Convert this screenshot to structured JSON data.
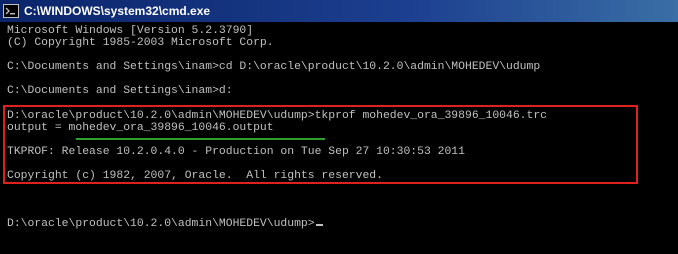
{
  "window": {
    "title": "C:\\WINDOWS\\system32\\cmd.exe"
  },
  "console": {
    "lines": [
      "Microsoft Windows [Version 5.2.3790]",
      "(C) Copyright 1985-2003 Microsoft Corp.",
      "",
      "C:\\Documents and Settings\\inam>cd D:\\oracle\\product\\10.2.0\\admin\\MOHEDEV\\udump",
      "",
      "C:\\Documents and Settings\\inam>d:",
      "",
      "D:\\oracle\\product\\10.2.0\\admin\\MOHEDEV\\udump>tkprof mohedev_ora_39896_10046.trc",
      "output = mohedev_ora_39896_10046.output",
      "",
      "TKPROF: Release 10.2.0.4.0 - Production on Tue Sep 27 10:30:53 2011",
      "",
      "Copyright (c) 1982, 2007, Oracle.  All rights reserved.",
      "",
      "",
      "",
      "D:\\oracle\\product\\10.2.0\\admin\\MOHEDEV\\udump>"
    ]
  },
  "annotations": {
    "box_color": "#e0201c",
    "underline_color": "#2ea02e"
  },
  "colors": {
    "console_bg": "#000000",
    "console_text": "#c0c0c0",
    "titlebar": "#0a246a"
  },
  "icons": {
    "title": "cmd-icon"
  }
}
